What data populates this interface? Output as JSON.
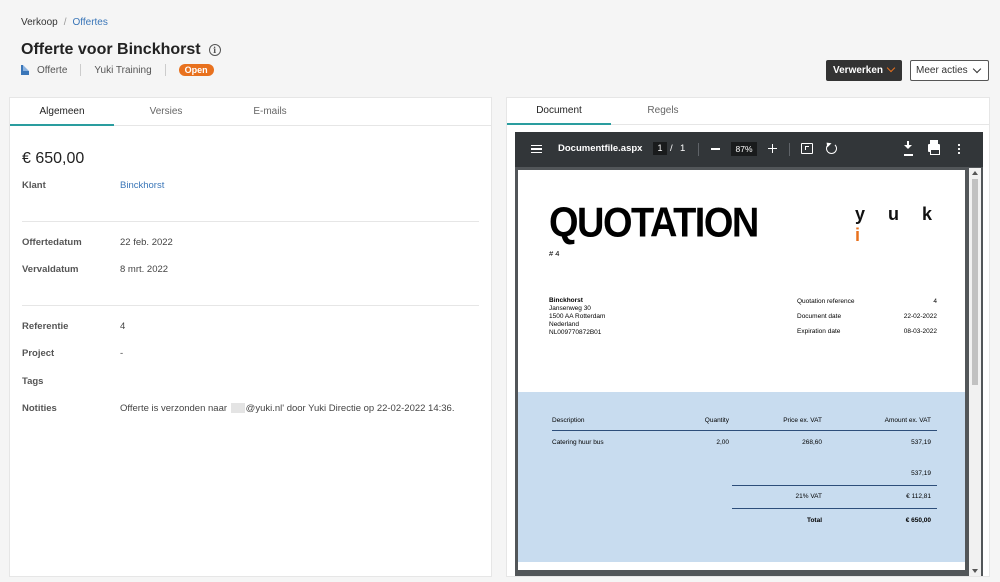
{
  "breadcrumb": {
    "root": "Verkoop",
    "separator": "/",
    "current": "Offertes"
  },
  "page": {
    "title": "Offerte voor Binckhorst",
    "info_icon": "i"
  },
  "meta": {
    "type": "Offerte",
    "company": "Yuki Training",
    "status": "Open"
  },
  "actions": {
    "process": "Verwerken",
    "more": "Meer acties"
  },
  "colors": {
    "accent": "#e8711e",
    "tab_underline": "#2a9d9f",
    "link": "#3a76b8"
  },
  "left": {
    "tabs": [
      "Algemeen",
      "Versies",
      "E-mails"
    ],
    "amount": "€ 650,00",
    "fields": {
      "client_label": "Klant",
      "client_value": "Binckhorst",
      "quote_date_label": "Offertedatum",
      "quote_date_value": "22 feb. 2022",
      "expiry_label": "Vervaldatum",
      "expiry_value": "8 mrt. 2022",
      "reference_label": "Referentie",
      "reference_value": "4",
      "project_label": "Project",
      "project_value": "-",
      "tags_label": "Tags",
      "notes_label": "Notities",
      "notes_prefix": "Offerte is verzonden naar",
      "notes_suffix": "@yuki.nl' door Yuki Directie op 22-02-2022 14:36."
    }
  },
  "right": {
    "tabs": [
      "Document",
      "Regels"
    ],
    "viewer": {
      "file_name": "Documentfile.aspx",
      "page": "1",
      "page_sep": "/",
      "page_total": "1",
      "zoom": "87%"
    },
    "pdf": {
      "title": "QUOTATION",
      "number": "# 4",
      "logo": "yuki",
      "address": [
        "Binckhorst",
        "Jansenweg 30",
        "1500 AA Rotterdam",
        "Nederland",
        "NL009770872B01"
      ],
      "refs": [
        {
          "label": "Quotation reference",
          "value": "4"
        },
        {
          "label": "Document date",
          "value": "22-02-2022"
        },
        {
          "label": "Expiration date",
          "value": "08-03-2022"
        }
      ],
      "headers": {
        "description": "Description",
        "quantity": "Quantity",
        "price": "Price ex. VAT",
        "amount": "Amount ex. VAT"
      },
      "line": {
        "description": "Catering huur bus",
        "quantity": "2,00",
        "price": "268,60",
        "amount": "537,19"
      },
      "subtotal": "537,19",
      "vat_label": "21% VAT",
      "vat_value": "€ 112,81",
      "total_label": "Total",
      "total_value": "€ 650,00"
    }
  }
}
